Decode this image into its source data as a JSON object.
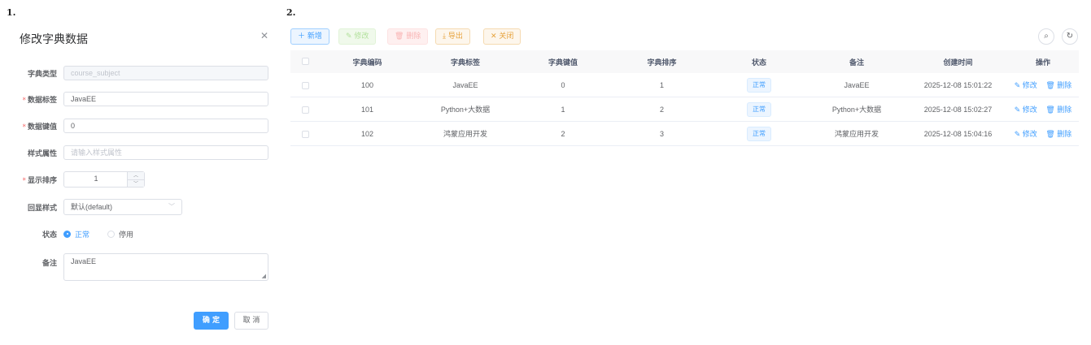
{
  "steps": {
    "one": "1.",
    "two": "2."
  },
  "dialog": {
    "title": "修改字典数据",
    "close_icon": "close-icon",
    "fields": {
      "dict_type": {
        "label": "字典类型",
        "value": "course_subject",
        "required": false,
        "disabled": true
      },
      "dict_label": {
        "label": "数据标签",
        "value": "JavaEE",
        "required": true
      },
      "dict_value": {
        "label": "数据键值",
        "value": "0",
        "required": true
      },
      "css_class": {
        "label": "样式属性",
        "placeholder": "请输入样式属性",
        "required": false
      },
      "dict_sort": {
        "label": "显示排序",
        "value": "1",
        "required": true
      },
      "list_class": {
        "label": "回显样式",
        "value": "默认(default)",
        "required": false
      },
      "status": {
        "label": "状态",
        "options": [
          "正常",
          "停用"
        ],
        "selected": "正常"
      },
      "remark": {
        "label": "备注",
        "value": "JavaEE"
      }
    },
    "required_mark": "*",
    "confirm_label": "确 定",
    "cancel_label": "取 消"
  },
  "toolbar": {
    "add": "新增",
    "edit": "修改",
    "delete": "删除",
    "export": "导出",
    "close": "关闭",
    "icons": {
      "add": "plus-icon",
      "edit": "edit-icon",
      "delete": "trash-icon",
      "export": "download-icon",
      "close": "close-icon",
      "search": "search-icon",
      "refresh": "refresh-icon"
    }
  },
  "table": {
    "headers": [
      "字典编码",
      "字典标签",
      "字典键值",
      "字典排序",
      "状态",
      "备注",
      "创建时间",
      "操作"
    ],
    "rows": [
      {
        "code": "100",
        "label": "JavaEE",
        "value": "0",
        "sort": "1",
        "status": "正常",
        "remark": "JavaEE",
        "created": "2025-12-08 15:01:22"
      },
      {
        "code": "101",
        "label": "Python+大数据",
        "value": "1",
        "sort": "2",
        "status": "正常",
        "remark": "Python+大数据",
        "created": "2025-12-08 15:02:27"
      },
      {
        "code": "102",
        "label": "鸿蒙应用开发",
        "value": "2",
        "sort": "3",
        "status": "正常",
        "remark": "鸿蒙应用开发",
        "created": "2025-12-08 15:04:16"
      }
    ],
    "row_actions": {
      "edit": "修改",
      "delete": "删除"
    }
  },
  "colors": {
    "primary": "#409eff",
    "danger": "#f56c6c",
    "warning": "#e6a23c",
    "success": "#67c23a"
  }
}
